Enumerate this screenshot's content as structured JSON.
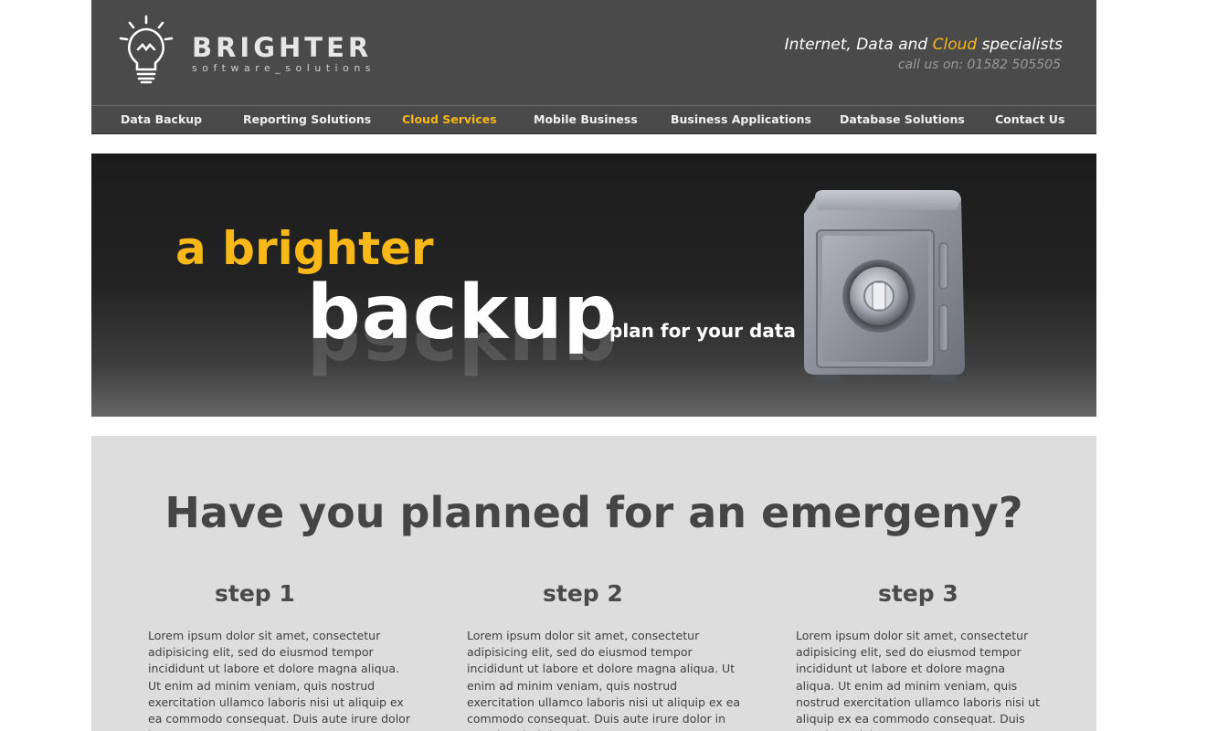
{
  "header": {
    "brand_name": "BRIGHTER",
    "brand_sub": "software_solutions",
    "tagline_prefix": "Internet, Data and ",
    "tagline_highlight": "Cloud",
    "tagline_suffix": " specialists",
    "phone": "call us on: 01582 505505"
  },
  "nav": {
    "items": [
      {
        "label": "Data Backup",
        "active": false
      },
      {
        "label": "Reporting Solutions",
        "active": false
      },
      {
        "label": "Cloud Services",
        "active": true
      },
      {
        "label": "Mobile Business",
        "active": false
      },
      {
        "label": "Business Applications",
        "active": false
      },
      {
        "label": "Database Solutions",
        "active": false
      },
      {
        "label": "Contact Us",
        "active": false
      }
    ]
  },
  "banner": {
    "line1": "a brighter",
    "line2": "backup",
    "line3": "plan for your data",
    "image_icon": "safe-icon"
  },
  "main": {
    "headline": "Have you planned for an emergeny?",
    "steps": [
      {
        "title": "step 1",
        "text": "Lorem ipsum dolor sit amet, consectetur adipisicing elit, sed do eiusmod tempor incididunt ut labore et dolore magna aliqua. Ut enim ad minim veniam, quis nostrud exercitation ullamco laboris nisi ut aliquip ex ea commodo consequat. Duis aute irure dolor in"
      },
      {
        "title": "step 2",
        "text": "Lorem ipsum dolor sit amet, consectetur adipisicing elit, sed do eiusmod tempor incididunt ut labore et dolore magna aliqua. Ut enim ad minim veniam, quis nostrud exercitation ullamco laboris nisi ut aliquip ex ea commodo consequat. Duis aute irure dolor in reprehenderit in voluptate"
      },
      {
        "title": "step 3",
        "text": "Lorem ipsum dolor sit amet, consectetur adipisicing elit, sed do eiusmod tempor incididunt ut labore et dolore magna aliqua. Ut enim ad minim veniam, quis nostrud exercitation ullamco laboris nisi ut aliquip ex ea commodo consequat. Duis aute irure dolor"
      }
    ]
  },
  "colors": {
    "header_bg": "#4a4a4a",
    "accent": "#f7b818",
    "content_bg": "#dddddd",
    "text_dark": "#454545"
  }
}
